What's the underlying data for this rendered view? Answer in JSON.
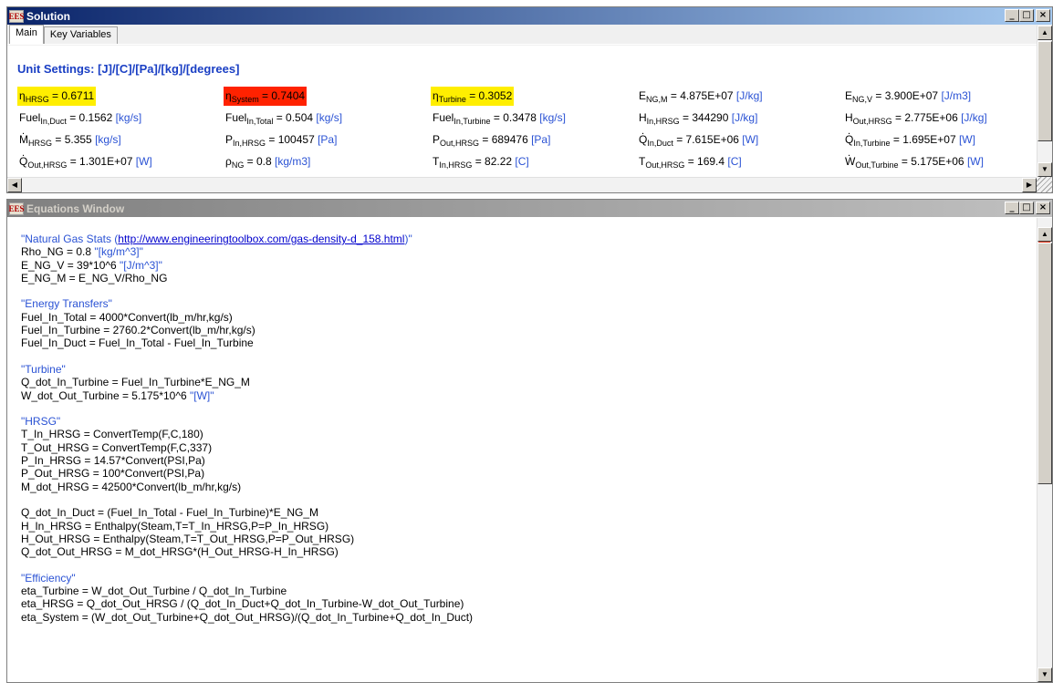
{
  "solution_window": {
    "title": "Solution",
    "icon_label": "EES",
    "controls": [
      "_",
      "□",
      "×"
    ],
    "tabs": [
      {
        "label": "Main",
        "active": true
      },
      {
        "label": "Key Variables",
        "active": false
      }
    ],
    "unit_settings": "Unit Settings: [J]/[C]/[Pa]/[kg]/[degrees]",
    "rows": [
      [
        {
          "symbol": "η",
          "sub": "HRSG",
          "value": " = 0.6711",
          "unit": "",
          "highlight": "#ffee00"
        },
        {
          "symbol": "η",
          "sub": "System",
          "value": " = 0.7404",
          "unit": "",
          "highlight": "#ff2200"
        },
        {
          "symbol": "η",
          "sub": "Turbine",
          "value": " = 0.3052",
          "unit": "",
          "highlight": "#ffee00"
        },
        {
          "symbol": "E",
          "sub": "NG,M",
          "value": "  = 4.875E+07 ",
          "unit": "[J/kg]"
        },
        {
          "symbol": "E",
          "sub": "NG,V",
          "value": " = 3.900E+07 ",
          "unit": "[J/m3]"
        }
      ],
      [
        {
          "symbol": "Fuel",
          "sub": "In,Duct",
          "value": " = 0.1562 ",
          "unit": "[kg/s]"
        },
        {
          "symbol": "Fuel",
          "sub": "In,Total",
          "value": " = 0.504 ",
          "unit": "[kg/s]"
        },
        {
          "symbol": "Fuel",
          "sub": "In,Turbine",
          "value": " = 0.3478 ",
          "unit": "[kg/s]"
        },
        {
          "symbol": "H",
          "sub": "In,HRSG",
          "value": "  = 344290 ",
          "unit": "[J/kg]"
        },
        {
          "symbol": "H",
          "sub": "Out,HRSG",
          "value": "  = 2.775E+06 ",
          "unit": "[J/kg]"
        }
      ],
      [
        {
          "symbol": "M",
          "sub": "HRSG",
          "value": " = 5.355 ",
          "unit": "[kg/s]",
          "dot": true
        },
        {
          "symbol": "P",
          "sub": "In,HRSG",
          "value": "  = 100457 ",
          "unit": " [Pa]"
        },
        {
          "symbol": "P",
          "sub": "Out,HRSG",
          "value": "  = 689476 ",
          "unit": " [Pa]"
        },
        {
          "symbol": "Q",
          "sub": "In,Duct",
          "value": "  = 7.615E+06 ",
          "unit": "[W]",
          "dot": true
        },
        {
          "symbol": "Q",
          "sub": "In,Turbine",
          "value": "  = 1.695E+07 ",
          "unit": "[W]",
          "dot": true
        }
      ],
      [
        {
          "symbol": "Q",
          "sub": "Out,HRSG",
          "value": "  = 1.301E+07 ",
          "unit": "[W]",
          "dot": true
        },
        {
          "symbol": "ρ",
          "sub": "NG",
          "value": " = 0.8 ",
          "unit": "[kg/m3]"
        },
        {
          "symbol": "T",
          "sub": "In,HRSG",
          "value": "  = 82.22 ",
          "unit": "[C]"
        },
        {
          "symbol": "T",
          "sub": "Out,HRSG",
          "value": "  = 169.4 ",
          "unit": "[C]"
        },
        {
          "symbol": "W",
          "sub": "Out,Turbine",
          "value": "  = 5.175E+06 ",
          "unit": "[W]",
          "dot": true
        }
      ]
    ]
  },
  "equations_window": {
    "title": "Equations Window",
    "icon_label": "EES",
    "controls": [
      "_",
      "□",
      "×"
    ],
    "lines": [
      {
        "parts": [
          {
            "t": "\"Natural Gas Stats (",
            "c": "cm"
          },
          {
            "t": "http://www.engineeringtoolbox.com/gas-density-d_158.html",
            "c": "lnk"
          },
          {
            "t": ")\"",
            "c": "cm"
          }
        ]
      },
      {
        "parts": [
          {
            "t": "Rho_NG = 0.8 ",
            "c": ""
          },
          {
            "t": "\"[kg/m^3]\"",
            "c": "cm"
          }
        ]
      },
      {
        "parts": [
          {
            "t": "E_NG_V = 39*10^6 ",
            "c": ""
          },
          {
            "t": "\"[J/m^3]\"",
            "c": "cm"
          }
        ]
      },
      {
        "parts": [
          {
            "t": "E_NG_M = E_NG_V/Rho_NG",
            "c": ""
          }
        ]
      },
      {
        "parts": []
      },
      {
        "parts": [
          {
            "t": "\"Energy Transfers\"",
            "c": "cm"
          }
        ]
      },
      {
        "parts": [
          {
            "t": "Fuel_In_Total = 4000*Convert(lb_m/hr,kg/s)",
            "c": ""
          }
        ]
      },
      {
        "parts": [
          {
            "t": "Fuel_In_Turbine = 2760.2*Convert(lb_m/hr,kg/s)",
            "c": ""
          }
        ]
      },
      {
        "parts": [
          {
            "t": "Fuel_In_Duct = Fuel_In_Total - Fuel_In_Turbine",
            "c": ""
          }
        ]
      },
      {
        "parts": []
      },
      {
        "parts": [
          {
            "t": "\"Turbine\"",
            "c": "cm"
          }
        ]
      },
      {
        "parts": [
          {
            "t": "Q_dot_In_Turbine = Fuel_In_Turbine*E_NG_M",
            "c": ""
          }
        ]
      },
      {
        "parts": [
          {
            "t": "W_dot_Out_Turbine = 5.175*10^6 ",
            "c": ""
          },
          {
            "t": "\"[W]\"",
            "c": "cm"
          }
        ]
      },
      {
        "parts": []
      },
      {
        "parts": [
          {
            "t": "\"HRSG\"",
            "c": "cm"
          }
        ]
      },
      {
        "parts": [
          {
            "t": "T_In_HRSG = ConvertTemp(F,C,180)",
            "c": ""
          }
        ]
      },
      {
        "parts": [
          {
            "t": "T_Out_HRSG = ConvertTemp(F,C,337)",
            "c": ""
          }
        ]
      },
      {
        "parts": [
          {
            "t": "P_In_HRSG = 14.57*Convert(PSI,Pa)",
            "c": ""
          }
        ]
      },
      {
        "parts": [
          {
            "t": "P_Out_HRSG = 100*Convert(PSI,Pa)",
            "c": ""
          }
        ]
      },
      {
        "parts": [
          {
            "t": "M_dot_HRSG = 42500*Convert(lb_m/hr,kg/s)",
            "c": ""
          }
        ]
      },
      {
        "parts": []
      },
      {
        "parts": [
          {
            "t": "Q_dot_In_Duct = (Fuel_In_Total - Fuel_In_Turbine)*E_NG_M",
            "c": ""
          }
        ]
      },
      {
        "parts": [
          {
            "t": "H_In_HRSG = Enthalpy(Steam,T=T_In_HRSG,P=P_In_HRSG)",
            "c": ""
          }
        ]
      },
      {
        "parts": [
          {
            "t": "H_Out_HRSG = Enthalpy(Steam,T=T_Out_HRSG,P=P_Out_HRSG)",
            "c": ""
          }
        ]
      },
      {
        "parts": [
          {
            "t": "Q_dot_Out_HRSG = M_dot_HRSG*(H_Out_HRSG-H_In_HRSG)",
            "c": ""
          }
        ]
      },
      {
        "parts": []
      },
      {
        "parts": [
          {
            "t": "\"Efficiency\"",
            "c": "cm"
          }
        ]
      },
      {
        "parts": [
          {
            "t": "eta_Turbine = W_dot_Out_Turbine / Q_dot_In_Turbine",
            "c": ""
          }
        ]
      },
      {
        "parts": [
          {
            "t": "eta_HRSG = Q_dot_Out_HRSG / (Q_dot_In_Duct+Q_dot_In_Turbine-W_dot_Out_Turbine)",
            "c": ""
          }
        ]
      },
      {
        "parts": [
          {
            "t": "eta_System = (W_dot_Out_Turbine+Q_dot_Out_HRSG)/(Q_dot_In_Turbine+Q_dot_In_Duct)",
            "c": ""
          }
        ]
      }
    ]
  },
  "scroll": {
    "up": "▲",
    "down": "▼",
    "left": "◀",
    "right": "▶"
  }
}
